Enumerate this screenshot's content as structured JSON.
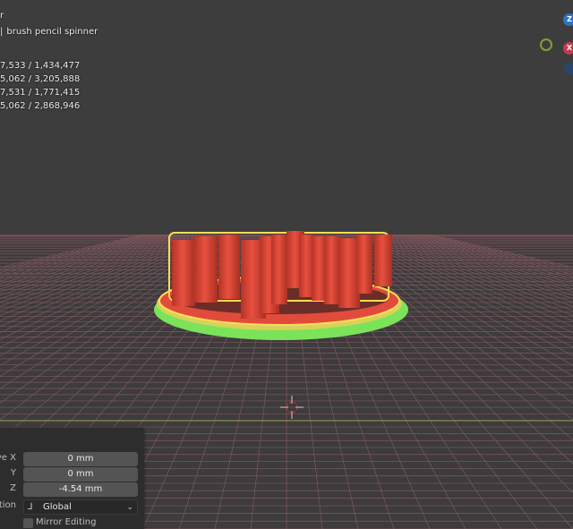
{
  "header": {
    "line1": "r",
    "line2": "brush pencil spinner"
  },
  "stats": [
    "7,533 / 1,434,477",
    "5,062 / 3,205,888",
    "7,531 / 1,771,415",
    "5,062 / 2,868,946"
  ],
  "gizmo": {
    "z_label": "Z",
    "x_label": "X",
    "colors": {
      "z": "#2f74c0",
      "x": "#c43a4f",
      "y": "#7ea333",
      "neg": "#2a4569"
    }
  },
  "panel": {
    "move_x_label": "ve X",
    "move_x_value": "0 mm",
    "y_label": "Y",
    "y_value": "0 mm",
    "z_label": "Z",
    "z_value": "-4.54 mm",
    "orientation_label": "ation",
    "orientation_value": "Global",
    "mirror_label": "Mirror Editing"
  },
  "colors": {
    "background": "#3d3d3d",
    "grid": "#8a5d64",
    "object_red": "#e14b3c",
    "selection_outline": "#ffdd55",
    "base_green": "#7be35a"
  }
}
